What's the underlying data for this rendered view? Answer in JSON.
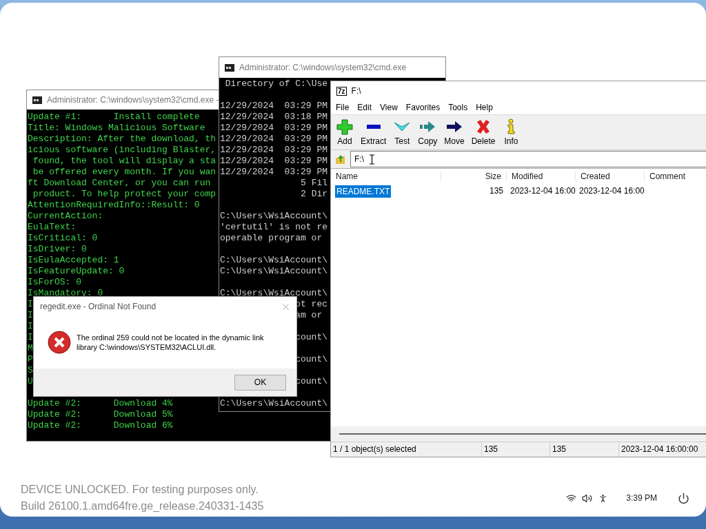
{
  "console_left": {
    "title": "Administrator: C:\\windows\\system32\\cmd.exe -",
    "blocks": [
      [
        "Update #1:      Install complete",
        "Title: Windows Malicious Software",
        "Description: After the download, th",
        "icious software (including Blaster,",
        " found, the tool will display a sta",
        " be offered every month. If you wan",
        "ft Download Center, or you can run ",
        " product. To help protect your comp",
        "AttentionRequiredInfo::Result: 0",
        "CurrentAction:",
        "EulaText:",
        "IsCritical: 0",
        "IsDriver: 0",
        "IsEulaAccepted: 1",
        "IsFeatureUpdate: 0",
        "IsForOS: 0",
        "IsMandatory: 0",
        "I",
        "I",
        "I",
        "I",
        "M",
        "P",
        "S",
        "U"
      ],
      [
        "Update #2:      Download 4%",
        "Update #2:      Download 5%",
        "Update #2:      Download 6%"
      ]
    ]
  },
  "console_middle": {
    "title": "Administrator: C:\\windows\\system32\\cmd.exe",
    "blocks": [
      [
        " Directory of C:\\Use"
      ],
      [
        "12/29/2024  03:29 PM",
        "12/29/2024  03:18 PM",
        "12/29/2024  03:29 PM",
        "12/29/2024  03:29 PM",
        "12/29/2024  03:29 PM",
        "12/29/2024  03:29 PM",
        "12/29/2024  03:29 PM",
        "               5 Fil",
        "               2 Dir"
      ],
      [
        "C:\\Users\\WsiAccount\\",
        "'certutil' is not re",
        "operable program or"
      ],
      [
        "C:\\Users\\WsiAccount\\",
        "C:\\Users\\WsiAccount\\"
      ],
      [
        "C:\\Users\\WsiAccount\\",
        "              ot rec",
        "              am or"
      ],
      [
        "              count\\"
      ],
      [
        "              count\\"
      ],
      [
        "              count\\"
      ],
      [
        "C:\\Users\\WsiAccount\\"
      ]
    ]
  },
  "archive_manager": {
    "logo": "7z",
    "title": "F:\\",
    "menu": [
      "File",
      "Edit",
      "View",
      "Favorites",
      "Tools",
      "Help"
    ],
    "toolbar": [
      {
        "kind": "add",
        "label": "Add"
      },
      {
        "kind": "extract",
        "label": "Extract"
      },
      {
        "kind": "test",
        "label": "Test"
      },
      {
        "kind": "copy",
        "label": "Copy"
      },
      {
        "kind": "move",
        "label": "Move"
      },
      {
        "kind": "delete",
        "label": "Delete"
      },
      {
        "kind": "info",
        "label": "Info"
      }
    ],
    "address": "F:\\",
    "columns": [
      "Name",
      "Size",
      "Modified",
      "Created",
      "Comment"
    ],
    "rows": [
      {
        "name": "README.TXT",
        "size": "135",
        "modified": "2023-12-04 16:00",
        "created": "2023-12-04 16:00",
        "selected": true
      }
    ],
    "status_bar": [
      "1 / 1 object(s) selected",
      "135",
      "135",
      "2023-12-04 16:00:00"
    ]
  },
  "error_dialog": {
    "title": "regedit.exe - Ordinal Not Found",
    "message": "The ordinal 259 could not be located in the dynamic link library C:\\windows\\SYSTEM32\\ACLUI.dll.",
    "button": "OK"
  },
  "notice": [
    "DEVICE UNLOCKED. For testing purposes only.",
    "Build 26100.1.amd64fre.ge_release.240331-1435"
  ],
  "tray": {
    "time": "3:39 PM"
  }
}
